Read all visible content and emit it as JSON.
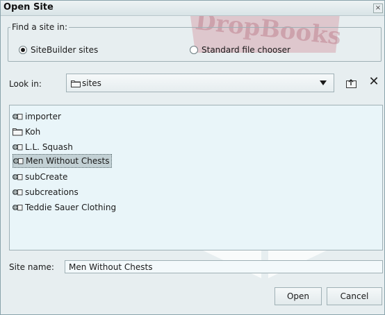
{
  "window": {
    "title": "Open Site",
    "close_glyph": "×"
  },
  "find_group": {
    "legend": "Find a site in:",
    "options": [
      {
        "label": "SiteBuilder sites",
        "selected": true
      },
      {
        "label": "Standard file chooser",
        "selected": false
      }
    ]
  },
  "look_in": {
    "label": "Look in:",
    "value": "sites",
    "icons": [
      "folder-icon",
      "chevron-down-icon",
      "up-folder-icon",
      "delete-icon"
    ]
  },
  "sites": [
    {
      "name": "importer",
      "icon": "site-icon",
      "selected": false
    },
    {
      "name": "Koh",
      "icon": "folder-icon",
      "selected": false
    },
    {
      "name": "L.L. Squash",
      "icon": "site-icon",
      "selected": false
    },
    {
      "name": "Men Without Chests",
      "icon": "site-icon",
      "selected": true
    },
    {
      "name": "subCreate",
      "icon": "site-icon",
      "selected": false
    },
    {
      "name": "subcreations",
      "icon": "site-icon",
      "selected": false
    },
    {
      "name": "Teddie Sauer Clothing",
      "icon": "site-icon",
      "selected": false
    }
  ],
  "site_name": {
    "label": "Site name:",
    "value": "Men Without Chests"
  },
  "buttons": {
    "open": "Open",
    "cancel": "Cancel"
  },
  "watermark": "DropBooks",
  "colors": {
    "background": "#e7eef0",
    "list_bg": "#e9f5f9",
    "selection": "#c2d0d4",
    "watermark": "#b83c4e"
  }
}
